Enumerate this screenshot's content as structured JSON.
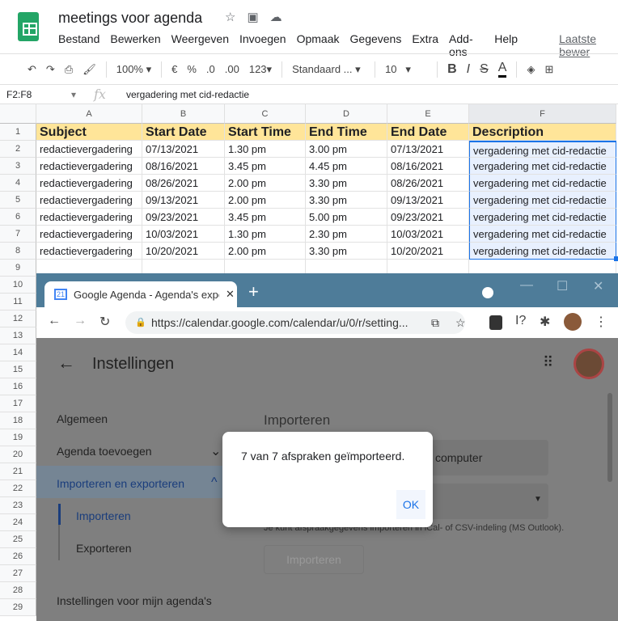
{
  "doc": {
    "title": "meetings voor agenda",
    "menu": [
      "Bestand",
      "Bewerken",
      "Weergeven",
      "Invoegen",
      "Opmaak",
      "Gegevens",
      "Extra",
      "Add-ons",
      "Help"
    ],
    "last_edit": "Laatste bewer"
  },
  "toolbar": {
    "zoom": "100%",
    "currency": "€",
    "percent": "%",
    "dec_less": ".0",
    "dec_more": ".00",
    "format": "123",
    "font": "Standaard ...",
    "size": "10",
    "bold": "B",
    "italic": "I",
    "strike": "S",
    "textcolor": "A"
  },
  "formula": {
    "range": "F2:F8",
    "fx": "fx",
    "value": "vergadering met cid-redactie"
  },
  "columns": [
    "A",
    "B",
    "C",
    "D",
    "E",
    "F"
  ],
  "rows": [
    "1",
    "2",
    "3",
    "4",
    "5",
    "6",
    "7",
    "8",
    "9",
    "10",
    "11",
    "12",
    "13",
    "14",
    "15",
    "16",
    "17",
    "18",
    "19",
    "20",
    "21",
    "22",
    "23",
    "24",
    "25",
    "26",
    "27",
    "28",
    "29"
  ],
  "table": {
    "headers": [
      "Subject",
      "Start Date",
      "Start Time",
      "End Time",
      "End Date",
      "Description"
    ],
    "data": [
      [
        "redactievergadering",
        "07/13/2021",
        "1.30 pm",
        "3.00 pm",
        "07/13/2021",
        "vergadering met cid-redactie"
      ],
      [
        "redactievergadering",
        "08/16/2021",
        "3.45 pm",
        "4.45 pm",
        "08/16/2021",
        "vergadering met cid-redactie"
      ],
      [
        "redactievergadering",
        "08/26/2021",
        "2.00 pm",
        "3.30 pm",
        "08/26/2021",
        "vergadering met cid-redactie"
      ],
      [
        "redactievergadering",
        "09/13/2021",
        "2.00 pm",
        "3.30 pm",
        "09/13/2021",
        "vergadering met cid-redactie"
      ],
      [
        "redactievergadering",
        "09/23/2021",
        "3.45 pm",
        "5.00 pm",
        "09/23/2021",
        "vergadering met cid-redactie"
      ],
      [
        "redactievergadering",
        "10/03/2021",
        "1.30 pm",
        "2.30 pm",
        "10/03/2021",
        "vergadering met cid-redactie"
      ],
      [
        "redactievergadering",
        "10/20/2021",
        "2.00 pm",
        "3.30 pm",
        "10/20/2021",
        "vergadering met cid-redactie"
      ]
    ]
  },
  "browser": {
    "tab_title": "Google Agenda - Agenda's expor",
    "tab_icon_text": "21",
    "url": "https://calendar.google.com/calendar/u/0/r/setting...",
    "accent": "#4e7c99"
  },
  "calendar": {
    "title": "Instellingen",
    "nav": [
      "Algemeen",
      "Agenda toevoegen",
      "Importeren en exporteren",
      "Importeren",
      "Exporteren",
      "Instellingen voor mijn agenda's"
    ],
    "section": "Importeren",
    "file_btn": "computer",
    "hint": "Je kunt afspraakgegevens importeren in iCal- of CSV-indeling (MS Outlook).",
    "import_btn": "Importeren"
  },
  "dialog": {
    "message": "7 van 7 afspraken geïmporteerd.",
    "ok": "OK"
  }
}
